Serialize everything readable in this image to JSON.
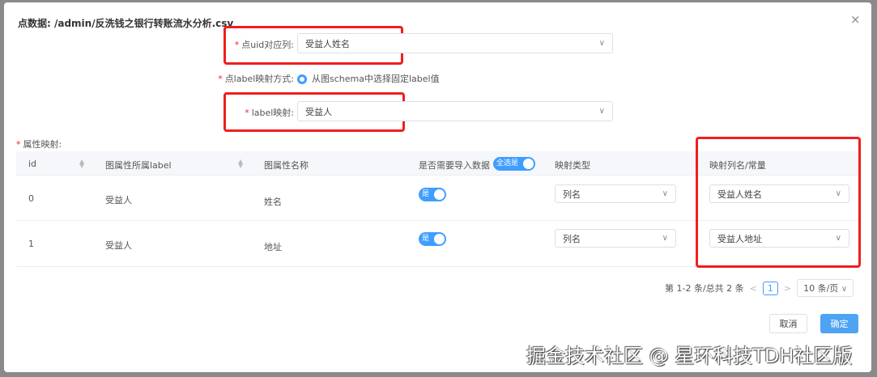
{
  "dialog": {
    "title": "点数据: /admin/反洗钱之银行转账流水分析.csv",
    "close": "×"
  },
  "form": {
    "uid_label": "点uid对应列:",
    "uid_value": "受益人姓名",
    "label_mode_label": "点label映射方式:",
    "label_mode_option": "从图schema中选择固定label值",
    "label_map_label": "label映射:",
    "label_map_value": "受益人",
    "attr_label": "属性映射:",
    "required_mark": "*"
  },
  "table": {
    "headers": [
      "id",
      "图属性所属label",
      "图属性名称",
      "是否需要导入数据",
      "映射类型",
      "映射列名/常量"
    ],
    "select_all_toggle": "全选是",
    "rows": [
      {
        "id": "0",
        "label": "受益人",
        "name": "姓名",
        "toggle": "是",
        "map_type": "列名",
        "map_col": "受益人姓名"
      },
      {
        "id": "1",
        "label": "受益人",
        "name": "地址",
        "toggle": "是",
        "map_type": "列名",
        "map_col": "受益人地址"
      }
    ]
  },
  "pagination": {
    "summary": "第 1-2 条/总共 2 条",
    "prev": "<",
    "page": "1",
    "next": ">",
    "page_size": "10 条/页"
  },
  "footer": {
    "cancel": "取消",
    "ok": "确定"
  },
  "watermark": "掘金技术社区 @ 星环科技TDH社区版",
  "colors": {
    "primary": "#409eff",
    "highlight": "#f01e1e"
  }
}
